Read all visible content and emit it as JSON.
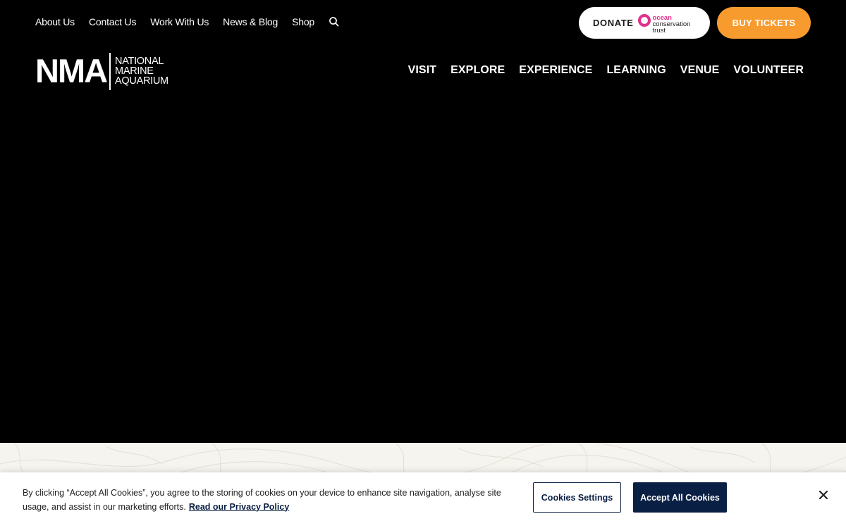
{
  "utility_nav": {
    "items": [
      {
        "label": "About Us"
      },
      {
        "label": "Contact Us"
      },
      {
        "label": "Work With Us"
      },
      {
        "label": "News & Blog"
      },
      {
        "label": "Shop"
      }
    ],
    "search_icon": "search-icon"
  },
  "donate": {
    "label": "DONATE",
    "partner_line1": "ocean",
    "partner_line2": "conservation",
    "partner_line3": "trust",
    "partner_color": "#e0318b"
  },
  "tickets": {
    "label": "BUY TICKETS",
    "color": "#f89b2e"
  },
  "logo": {
    "mark": "NMA",
    "line1": "NATIONAL",
    "line2": "MARINE",
    "line3": "AQUARIUM"
  },
  "main_nav": {
    "items": [
      {
        "label": "VISIT"
      },
      {
        "label": "EXPLORE"
      },
      {
        "label": "EXPERIENCE"
      },
      {
        "label": "LEARNING"
      },
      {
        "label": "VENUE"
      },
      {
        "label": "VOLUNTEER"
      }
    ]
  },
  "cookie_banner": {
    "text": "By clicking “Accept All Cookies”, you agree to the storing of cookies on your device to enhance site navigation, analyse site usage, and assist in our marketing efforts.",
    "policy_link": "Read our Privacy Policy",
    "settings_label": "Cookies Settings",
    "accept_label": "Accept All Cookies",
    "close_icon": "close-icon",
    "accent": "#0a1f44"
  }
}
